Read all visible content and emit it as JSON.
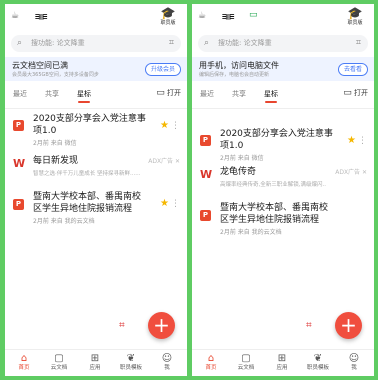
{
  "screens": [
    {
      "status": {
        "left_glyph": "☕",
        "mid_glyph": "≡▥≡",
        "chat_glyph": "",
        "right_label": "职员版"
      },
      "search": {
        "placeholder": "搜功能: 论文降重"
      },
      "banner": {
        "title": "云文档空间已满",
        "subtitle": "会员最大365GB空间，支持多设备同步",
        "button": "升级会员"
      },
      "tabs": [
        "最近",
        "共享",
        "星标"
      ],
      "open_label": "打开",
      "items": [
        {
          "icon_letter": "P",
          "title_line1": "2020支部分享会入党注意事",
          "title_line2": "项1.0",
          "meta": "2月前  来自 微信"
        },
        {
          "title": "每日新发现",
          "subtitle": "智慧之选·伴千万儿童成长 坚持探寻新鲜......",
          "ad": "ADX广告 ✕"
        },
        {
          "icon_letter": "P",
          "title_line1": "暨南大学校本部、番禺南校",
          "title_line2": "区学生异地住院报销流程",
          "meta": "2月前  来自 我的云文档"
        }
      ],
      "nav": [
        "首页",
        "云文档",
        "应用",
        "职员模板",
        "我"
      ]
    },
    {
      "status": {
        "left_glyph": "☕",
        "mid_glyph": "≡▥≡",
        "chat_glyph": "▭",
        "right_label": "职员版"
      },
      "search": {
        "placeholder": "搜功能: 论文降重"
      },
      "banner": {
        "title": "用手机，访问电脑文件",
        "subtitle": "编辑后保存，电脑也会自动更新",
        "button": "去看看"
      },
      "tabs": [
        "最近",
        "共享",
        "星标"
      ],
      "open_label": "打开",
      "items": [
        {
          "icon_letter": "P",
          "title_line1": "2020支部分享会入党注意事",
          "title_line2": "项1.0",
          "meta": "2月前  来自 微信"
        },
        {
          "title": "龙龟传奇",
          "subtitle": "高爆率经典传奇,全新三职业解锁,满级爆闪..",
          "ad": "ADX广告 ✕"
        },
        {
          "icon_letter": "P",
          "title_line1": "暨南大学校本部、番禺南校",
          "title_line2": "区学生异地住院报销流程",
          "meta": "2月前  来自 我的云文档"
        }
      ],
      "nav": [
        "首页",
        "云文档",
        "应用",
        "职员模板",
        "我"
      ]
    }
  ],
  "colors": {
    "accent": "#e8462f",
    "star": "#f5b700",
    "background": "#5fcc63",
    "link": "#4a7cf6"
  },
  "icons": {
    "star": "★",
    "more": "⋮",
    "add": "+",
    "camera": "⌗",
    "search": "⌕",
    "scan": "⌗",
    "folder": "▭"
  }
}
